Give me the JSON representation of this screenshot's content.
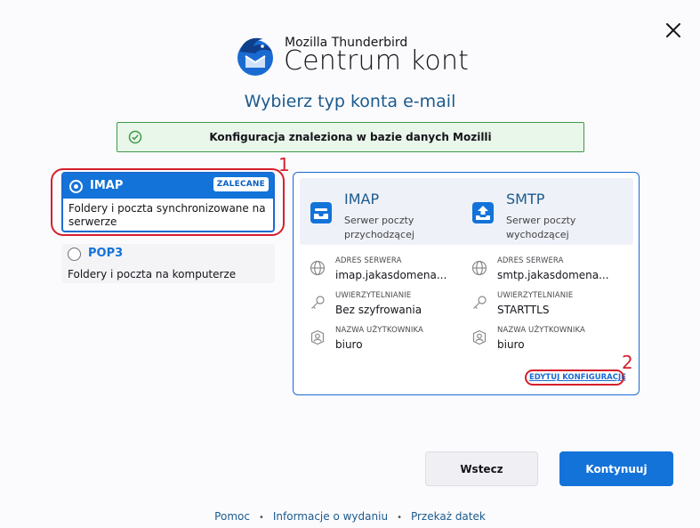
{
  "brand": {
    "small": "Mozilla Thunderbird",
    "big": "Centrum kont"
  },
  "heading": "Wybierz typ konta e-mail",
  "notice": {
    "text": "Konfiguracja znaleziona w bazie danych Mozilli",
    "color": "#3d9a47"
  },
  "options": [
    {
      "name": "IMAP",
      "badge": "ZALECANE",
      "desc": "Foldery i poczta synchronizowane na serwerze",
      "selected": true
    },
    {
      "name": "POP3",
      "desc": "Foldery i poczta na komputerze",
      "selected": false
    }
  ],
  "annotations": {
    "one": "1",
    "two": "2"
  },
  "incoming": {
    "title": "IMAP",
    "subtitle": "Serwer poczty przychodzącej",
    "server_label": "ADRES SERWERA",
    "server": "imap.jakasdomena...",
    "auth_label": "UWIERZYTELNIANIE",
    "auth": "Bez szyfrowania",
    "user_label": "NAZWA UŻYTKOWNIKA",
    "user": "biuro"
  },
  "outgoing": {
    "title": "SMTP",
    "subtitle": "Serwer poczty wychodzącej",
    "server_label": "ADRES SERWERA",
    "server": "smtp.jakasdomena...",
    "auth_label": "UWIERZYTELNIANIE",
    "auth": "STARTTLS",
    "user_label": "NAZWA UŻYTKOWNIKA",
    "user": "biuro"
  },
  "edit_link": "EDYTUJ KONFIGURACJĘ",
  "buttons": {
    "back": "Wstecz",
    "next": "Kontynuuj"
  },
  "footer": {
    "help": "Pomoc",
    "release": "Informacje o wydaniu",
    "donate": "Przekaż datek"
  },
  "colors": {
    "accent": "#1373d9",
    "annotation": "#d61f2c"
  }
}
